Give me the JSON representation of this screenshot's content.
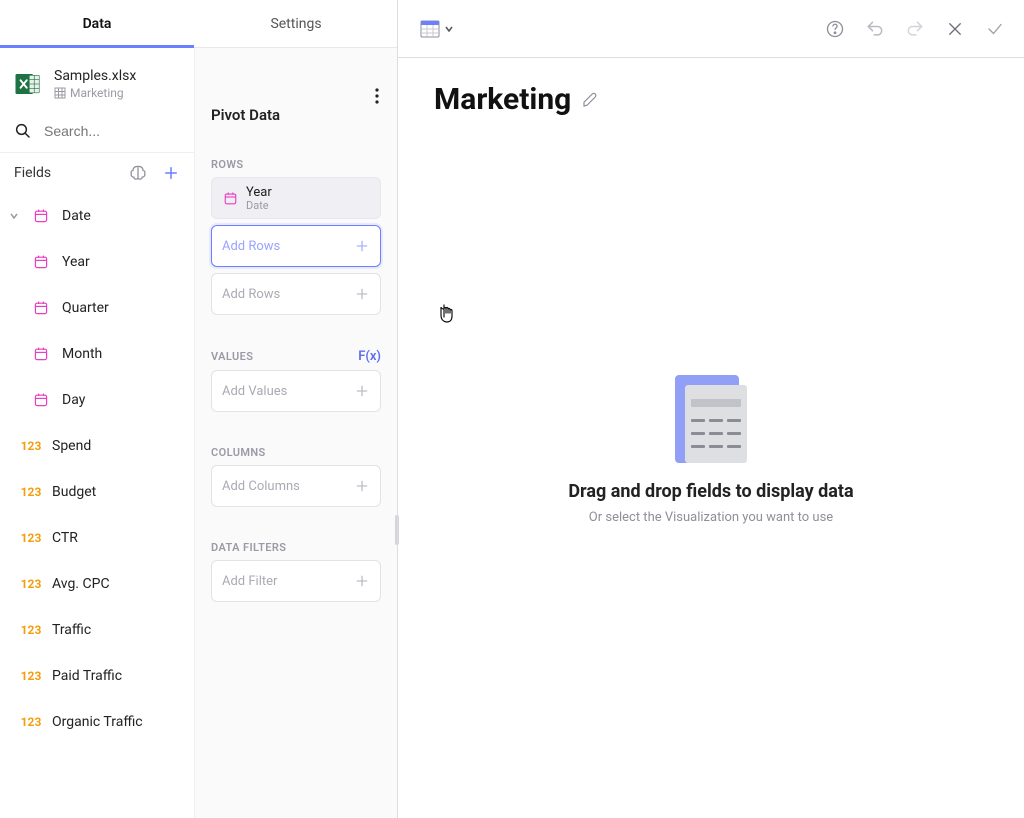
{
  "tabs": {
    "data": "Data",
    "settings": "Settings"
  },
  "file": {
    "name": "Samples.xlsx",
    "sheet": "Marketing"
  },
  "search": {
    "placeholder": "Search..."
  },
  "fields_header": {
    "label": "Fields"
  },
  "fields": {
    "date_group": {
      "label": "Date"
    },
    "year": {
      "label": "Year"
    },
    "quarter": {
      "label": "Quarter"
    },
    "month": {
      "label": "Month"
    },
    "day": {
      "label": "Day"
    },
    "spend": {
      "label": "Spend",
      "prefix": "123"
    },
    "budget": {
      "label": "Budget",
      "prefix": "123"
    },
    "ctr": {
      "label": "CTR",
      "prefix": "123"
    },
    "avg_cpc": {
      "label": "Avg. CPC",
      "prefix": "123"
    },
    "traffic": {
      "label": "Traffic",
      "prefix": "123"
    },
    "paid_traffic": {
      "label": "Paid Traffic",
      "prefix": "123"
    },
    "organic_traffic": {
      "label": "Organic Traffic",
      "prefix": "123"
    }
  },
  "pivot": {
    "title": "Pivot Data",
    "rows_label": "ROWS",
    "row_item": {
      "main": "Year",
      "sub": "Date"
    },
    "add_rows": "Add Rows",
    "values_label": "VALUES",
    "fx": "F(x)",
    "add_values": "Add Values",
    "columns_label": "COLUMNS",
    "add_columns": "Add Columns",
    "filters_label": "DATA FILTERS",
    "add_filter": "Add Filter"
  },
  "page": {
    "title": "Marketing"
  },
  "canvas": {
    "headline": "Drag and drop fields to display data",
    "subline": "Or select the Visualization you want to use"
  }
}
